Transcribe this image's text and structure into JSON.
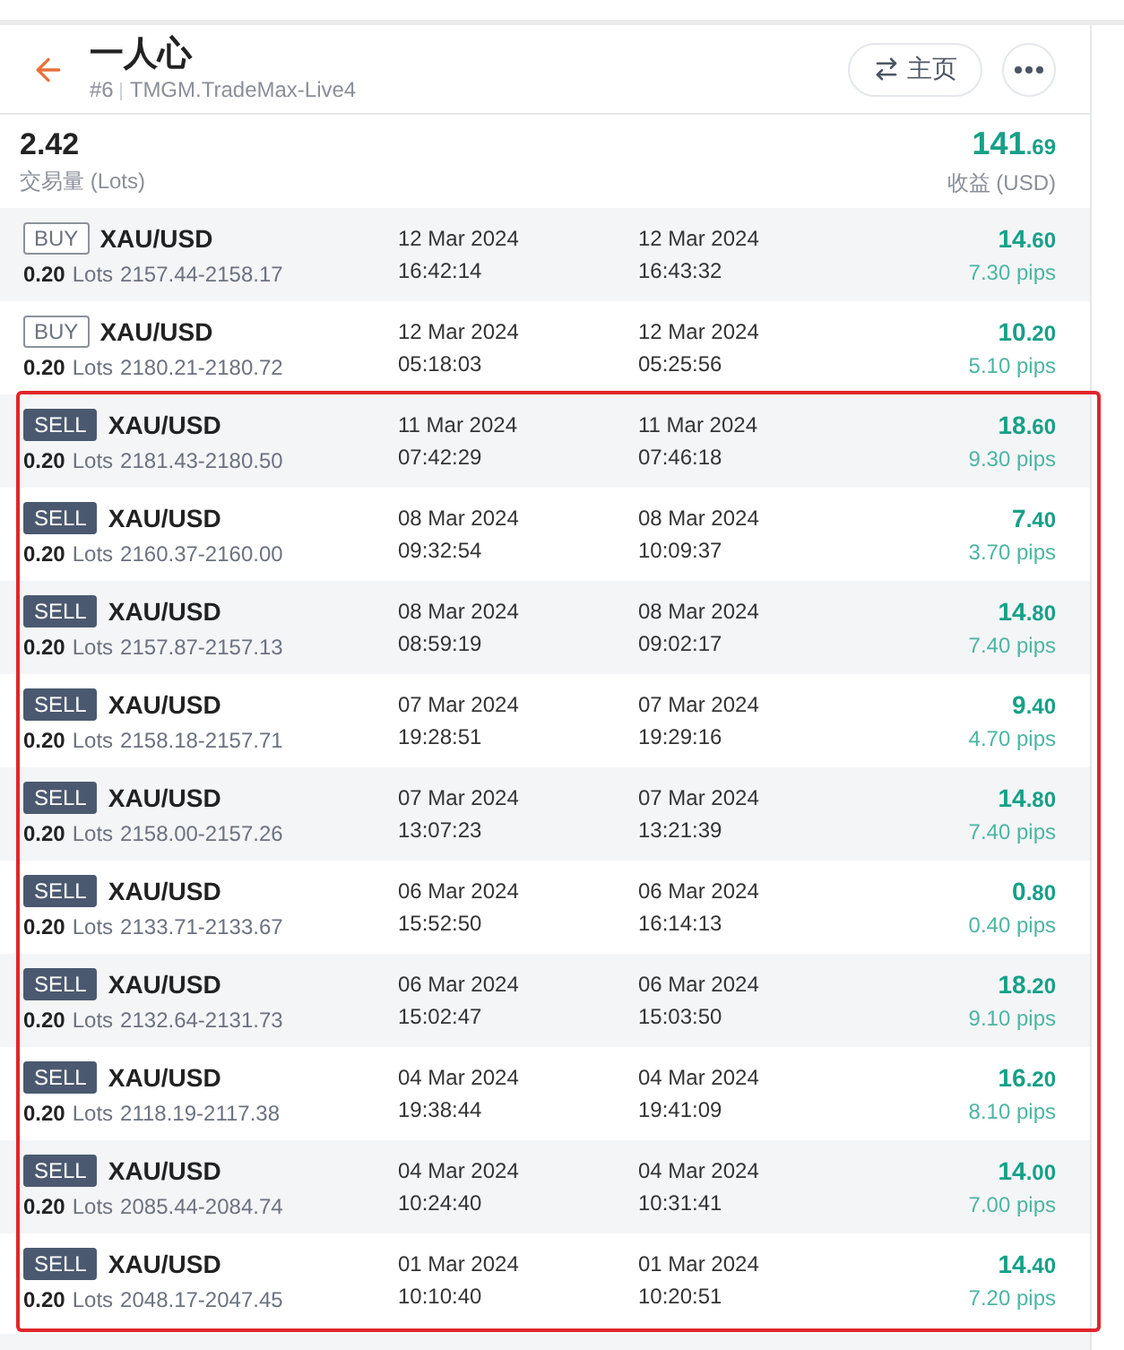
{
  "header": {
    "title": "一人心",
    "rank": "#6",
    "server": "TMGM.TradeMax-Live4",
    "home_button": "主页"
  },
  "summary": {
    "volume": "2.42",
    "volume_label": "交易量 (Lots)",
    "profit": "141.69",
    "profit_label": "收益 (USD)"
  },
  "trades": [
    {
      "kind": "buy",
      "side": "BUY",
      "symbol": "XAU/USD",
      "lots": "0.20",
      "lots_label": "Lots",
      "price_range": "2157.44-2158.17",
      "open_date": "12 Mar 2024",
      "open_time": "16:42:14",
      "close_date": "12 Mar 2024",
      "close_time": "16:43:32",
      "profit": "14.60",
      "pips": "7.30 pips",
      "highlighted": false
    },
    {
      "kind": "buy",
      "side": "BUY",
      "symbol": "XAU/USD",
      "lots": "0.20",
      "lots_label": "Lots",
      "price_range": "2180.21-2180.72",
      "open_date": "12 Mar 2024",
      "open_time": "05:18:03",
      "close_date": "12 Mar 2024",
      "close_time": "05:25:56",
      "profit": "10.20",
      "pips": "5.10 pips",
      "highlighted": false
    },
    {
      "kind": "sell",
      "side": "SELL",
      "symbol": "XAU/USD",
      "lots": "0.20",
      "lots_label": "Lots",
      "price_range": "2181.43-2180.50",
      "open_date": "11 Mar 2024",
      "open_time": "07:42:29",
      "close_date": "11 Mar 2024",
      "close_time": "07:46:18",
      "profit": "18.60",
      "pips": "9.30 pips",
      "highlighted": true
    },
    {
      "kind": "sell",
      "side": "SELL",
      "symbol": "XAU/USD",
      "lots": "0.20",
      "lots_label": "Lots",
      "price_range": "2160.37-2160.00",
      "open_date": "08 Mar 2024",
      "open_time": "09:32:54",
      "close_date": "08 Mar 2024",
      "close_time": "10:09:37",
      "profit": "7.40",
      "pips": "3.70 pips",
      "highlighted": true
    },
    {
      "kind": "sell",
      "side": "SELL",
      "symbol": "XAU/USD",
      "lots": "0.20",
      "lots_label": "Lots",
      "price_range": "2157.87-2157.13",
      "open_date": "08 Mar 2024",
      "open_time": "08:59:19",
      "close_date": "08 Mar 2024",
      "close_time": "09:02:17",
      "profit": "14.80",
      "pips": "7.40 pips",
      "highlighted": true
    },
    {
      "kind": "sell",
      "side": "SELL",
      "symbol": "XAU/USD",
      "lots": "0.20",
      "lots_label": "Lots",
      "price_range": "2158.18-2157.71",
      "open_date": "07 Mar 2024",
      "open_time": "19:28:51",
      "close_date": "07 Mar 2024",
      "close_time": "19:29:16",
      "profit": "9.40",
      "pips": "4.70 pips",
      "highlighted": true
    },
    {
      "kind": "sell",
      "side": "SELL",
      "symbol": "XAU/USD",
      "lots": "0.20",
      "lots_label": "Lots",
      "price_range": "2158.00-2157.26",
      "open_date": "07 Mar 2024",
      "open_time": "13:07:23",
      "close_date": "07 Mar 2024",
      "close_time": "13:21:39",
      "profit": "14.80",
      "pips": "7.40 pips",
      "highlighted": true
    },
    {
      "kind": "sell",
      "side": "SELL",
      "symbol": "XAU/USD",
      "lots": "0.20",
      "lots_label": "Lots",
      "price_range": "2133.71-2133.67",
      "open_date": "06 Mar 2024",
      "open_time": "15:52:50",
      "close_date": "06 Mar 2024",
      "close_time": "16:14:13",
      "profit": "0.80",
      "pips": "0.40 pips",
      "highlighted": true
    },
    {
      "kind": "sell",
      "side": "SELL",
      "symbol": "XAU/USD",
      "lots": "0.20",
      "lots_label": "Lots",
      "price_range": "2132.64-2131.73",
      "open_date": "06 Mar 2024",
      "open_time": "15:02:47",
      "close_date": "06 Mar 2024",
      "close_time": "15:03:50",
      "profit": "18.20",
      "pips": "9.10 pips",
      "highlighted": true
    },
    {
      "kind": "sell",
      "side": "SELL",
      "symbol": "XAU/USD",
      "lots": "0.20",
      "lots_label": "Lots",
      "price_range": "2118.19-2117.38",
      "open_date": "04 Mar 2024",
      "open_time": "19:38:44",
      "close_date": "04 Mar 2024",
      "close_time": "19:41:09",
      "profit": "16.20",
      "pips": "8.10 pips",
      "highlighted": true
    },
    {
      "kind": "sell",
      "side": "SELL",
      "symbol": "XAU/USD",
      "lots": "0.20",
      "lots_label": "Lots",
      "price_range": "2085.44-2084.74",
      "open_date": "04 Mar 2024",
      "open_time": "10:24:40",
      "close_date": "04 Mar 2024",
      "close_time": "10:31:41",
      "profit": "14.00",
      "pips": "7.00 pips",
      "highlighted": true
    },
    {
      "kind": "sell",
      "side": "SELL",
      "symbol": "XAU/USD",
      "lots": "0.20",
      "lots_label": "Lots",
      "price_range": "2048.17-2047.45",
      "open_date": "01 Mar 2024",
      "open_time": "10:10:40",
      "close_date": "01 Mar 2024",
      "close_time": "10:20:51",
      "profit": "14.40",
      "pips": "7.20 pips",
      "highlighted": true
    }
  ]
}
